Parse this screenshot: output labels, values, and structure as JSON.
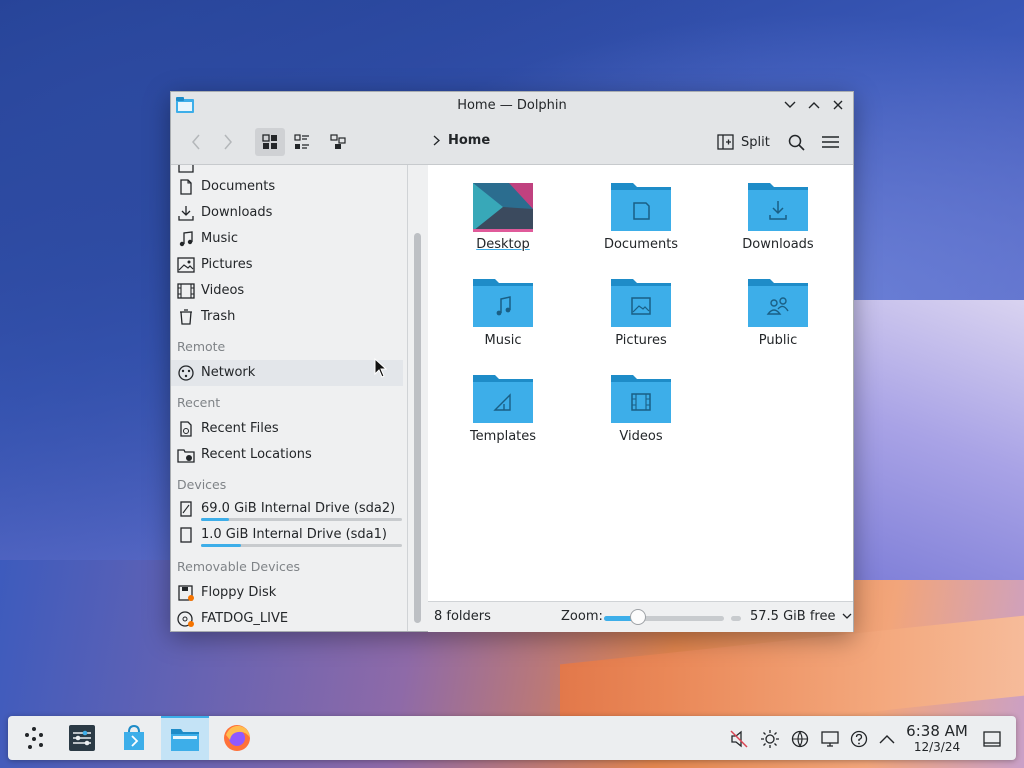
{
  "window": {
    "title": "Home — Dolphin"
  },
  "toolbar": {
    "breadcrumb": "Home",
    "split_label": "Split"
  },
  "sidebar": {
    "places": [
      {
        "label": "Documents",
        "icon": "document-icon"
      },
      {
        "label": "Downloads",
        "icon": "download-icon"
      },
      {
        "label": "Music",
        "icon": "music-icon"
      },
      {
        "label": "Pictures",
        "icon": "picture-icon"
      },
      {
        "label": "Videos",
        "icon": "video-icon"
      },
      {
        "label": "Trash",
        "icon": "trash-icon"
      }
    ],
    "remote_header": "Remote",
    "remote": [
      {
        "label": "Network",
        "icon": "network-icon"
      }
    ],
    "recent_header": "Recent",
    "recent": [
      {
        "label": "Recent Files",
        "icon": "recent-files-icon"
      },
      {
        "label": "Recent Locations",
        "icon": "recent-locations-icon"
      }
    ],
    "devices_header": "Devices",
    "devices": [
      {
        "label": "69.0 GiB Internal Drive (sda2)",
        "icon": "drive-icon",
        "usage": 0.14
      },
      {
        "label": "1.0 GiB Internal Drive (sda1)",
        "icon": "drive-icon",
        "usage": 0.2
      }
    ],
    "removable_header": "Removable Devices",
    "removable": [
      {
        "label": "Floppy Disk",
        "icon": "floppy-icon"
      },
      {
        "label": "FATDOG_LIVE",
        "icon": "disc-icon"
      }
    ]
  },
  "main": {
    "folders": [
      {
        "name": "Desktop",
        "icon": "desktop-folder-icon"
      },
      {
        "name": "Documents",
        "icon": "documents-folder-icon"
      },
      {
        "name": "Downloads",
        "icon": "downloads-folder-icon"
      },
      {
        "name": "Music",
        "icon": "music-folder-icon"
      },
      {
        "name": "Pictures",
        "icon": "pictures-folder-icon"
      },
      {
        "name": "Public",
        "icon": "public-folder-icon"
      },
      {
        "name": "Templates",
        "icon": "templates-folder-icon"
      },
      {
        "name": "Videos",
        "icon": "videos-folder-icon"
      }
    ]
  },
  "status": {
    "count": "8 folders",
    "zoom_label": "Zoom:",
    "zoom_level": 0.28,
    "free": "57.5 GiB free"
  },
  "taskbar": {
    "time": "6:38 AM",
    "date": "12/3/24"
  },
  "colors": {
    "accent": "#3daee9",
    "folder": "#3daee9",
    "folder_tab": "#1e8cc8"
  }
}
